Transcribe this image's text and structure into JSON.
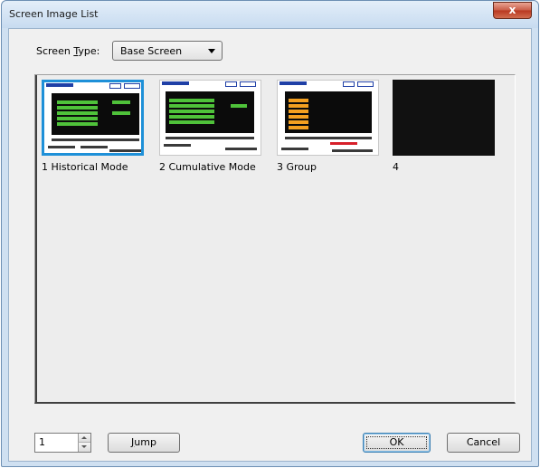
{
  "window": {
    "title": "Screen Image List",
    "close_label": "x"
  },
  "screen_type": {
    "label_prefix": "Screen ",
    "label_mnemonic": "T",
    "label_suffix": "ype:",
    "value": "Base Screen"
  },
  "screens": [
    {
      "caption": "1 Historical Mode",
      "selected": true,
      "accent": "#4fc23a"
    },
    {
      "caption": "2 Cumulative Mode",
      "selected": false,
      "accent": "#4fc23a"
    },
    {
      "caption": "3 Group",
      "selected": false,
      "accent": "#f4a020"
    },
    {
      "caption": "4",
      "selected": false,
      "accent": "#111111"
    }
  ],
  "footer": {
    "page_value": "1",
    "jump_mnemonic": "J",
    "jump_rest": "ump",
    "ok_label": "OK",
    "cancel_label": "Cancel"
  }
}
